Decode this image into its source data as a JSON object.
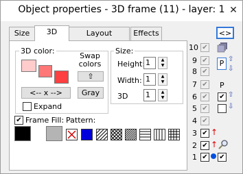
{
  "window": {
    "title": "Object properties - 3D frame (11) - layer: 1",
    "close_glyph": "✕"
  },
  "tabs": [
    {
      "label": "Size"
    },
    {
      "label": "3D"
    },
    {
      "label": "Layout manager"
    },
    {
      "label": "Effects"
    }
  ],
  "color_group": {
    "label": "3D color:",
    "colors": [
      "#ffcccc",
      "#ff7777",
      "#ff4040"
    ],
    "swap_label": "Swap colors",
    "up_glyph": "⇧",
    "swap_button": "<-- x -->",
    "gray_button": "Gray",
    "expand_label": "Expand",
    "expand_checked": false
  },
  "size_group": {
    "label": "Size:",
    "height_label": "Height:",
    "height_value": "1",
    "width_label": "Width:",
    "width_value": "1",
    "d3_label": "3D",
    "d3_value": "1"
  },
  "fill": {
    "frame_fill_label": "Frame Fill:",
    "frame_fill_checked": true,
    "pattern_label": "Pattern:",
    "fill_colors": [
      "#000000",
      "#b4b4b4"
    ],
    "pattern_blue": "#0000dd"
  },
  "layers": {
    "toggle_label": "<>",
    "numbers": [
      "10",
      "9",
      "8",
      "7",
      "6",
      "5",
      "4",
      "3",
      "2",
      "1"
    ],
    "p_label": "P",
    "p_label2": "P"
  }
}
